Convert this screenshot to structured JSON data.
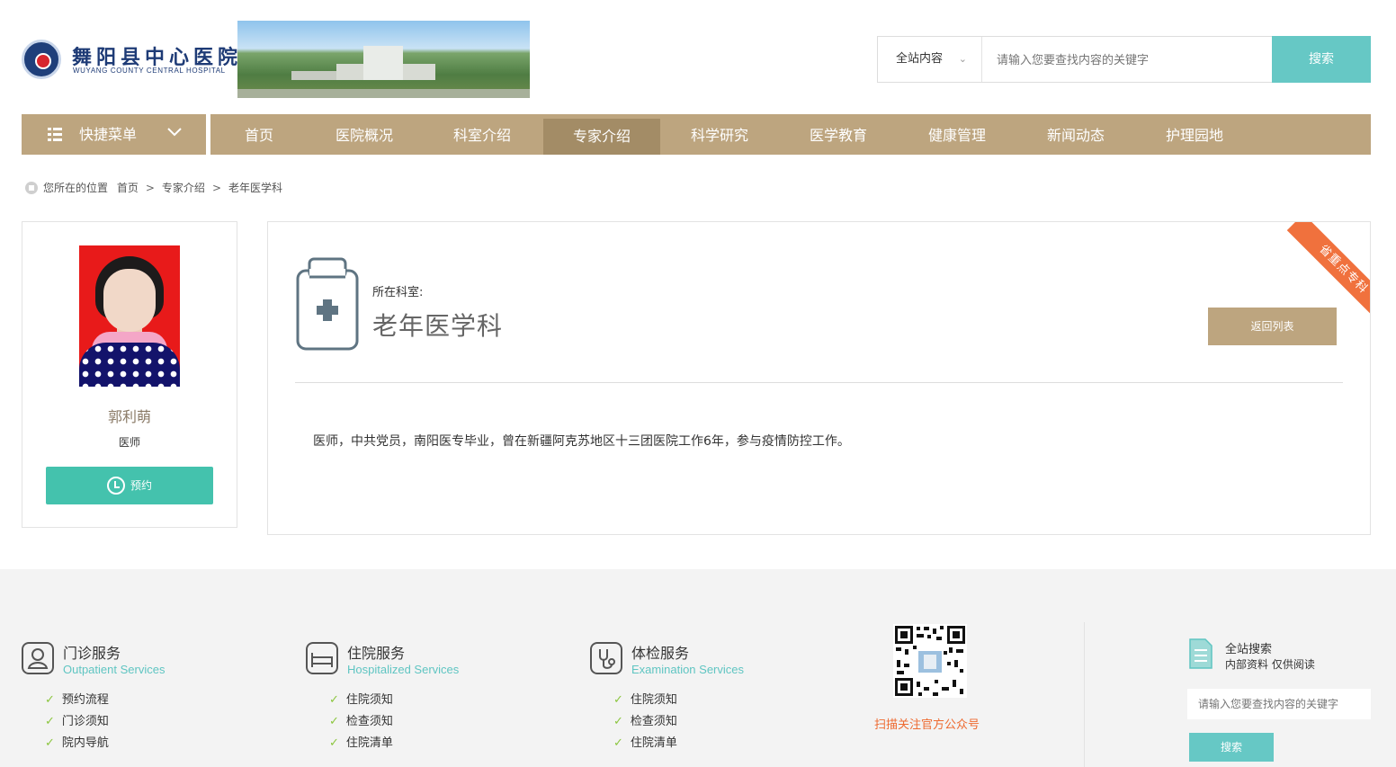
{
  "header": {
    "logo": {
      "name_cn": "舞阳县中心医院",
      "name_en": "WUYANG COUNTY CENTRAL HOSPITAL"
    },
    "search": {
      "scope_label": "全站内容",
      "placeholder": "请输入您要查找内容的关键字",
      "button_label": "搜索"
    }
  },
  "nav": {
    "quick_menu_label": "快捷菜单",
    "items": [
      {
        "label": "首页",
        "active": false
      },
      {
        "label": "医院概况",
        "active": false
      },
      {
        "label": "科室介绍",
        "active": false
      },
      {
        "label": "专家介绍",
        "active": true
      },
      {
        "label": "科学研究",
        "active": false
      },
      {
        "label": "医学教育",
        "active": false
      },
      {
        "label": "健康管理",
        "active": false
      },
      {
        "label": "新闻动态",
        "active": false
      },
      {
        "label": "护理园地",
        "active": false
      }
    ]
  },
  "breadcrumb": {
    "prefix": "您所在的位置",
    "items": [
      "首页",
      "专家介绍",
      "老年医学科"
    ],
    "separator": ">"
  },
  "doctor": {
    "name": "郭利萌",
    "title": "医师",
    "appointment_label": "预约"
  },
  "department": {
    "caption": "所在科室:",
    "name": "老年医学科",
    "back_label": "返回列表",
    "ribbon": "省重点专科",
    "bio": "医师，中共党员，南阳医专毕业，曾在新疆阿克苏地区十三团医院工作6年，参与疫情防控工作。"
  },
  "footer": {
    "services": [
      {
        "title": "门诊服务",
        "subtitle": "Outpatient Services",
        "icon": "doctor-icon",
        "links": [
          "预约流程",
          "门诊须知",
          "院内导航"
        ]
      },
      {
        "title": "住院服务",
        "subtitle": "Hospitalized Services",
        "icon": "bed-icon",
        "links": [
          "住院须知",
          "检查须知",
          "住院清单"
        ]
      },
      {
        "title": "体检服务",
        "subtitle": "Examination Services",
        "icon": "stethoscope-icon",
        "links": [
          "住院须知",
          "检查须知",
          "住院清单"
        ]
      }
    ],
    "qr_caption": "扫描关注官方公众号",
    "site_search": {
      "title": "全站搜索",
      "subtitle": "内部资料 仅供阅读",
      "placeholder": "请输入您要查找内容的关键字",
      "button_label": "搜索"
    }
  },
  "colors": {
    "nav_bg": "#bda57f",
    "nav_active": "#a38c66",
    "accent_teal": "#66c8c5",
    "appointment_green": "#44c2ad",
    "ribbon_orange": "#f0713d",
    "check_green": "#8cc63f"
  }
}
